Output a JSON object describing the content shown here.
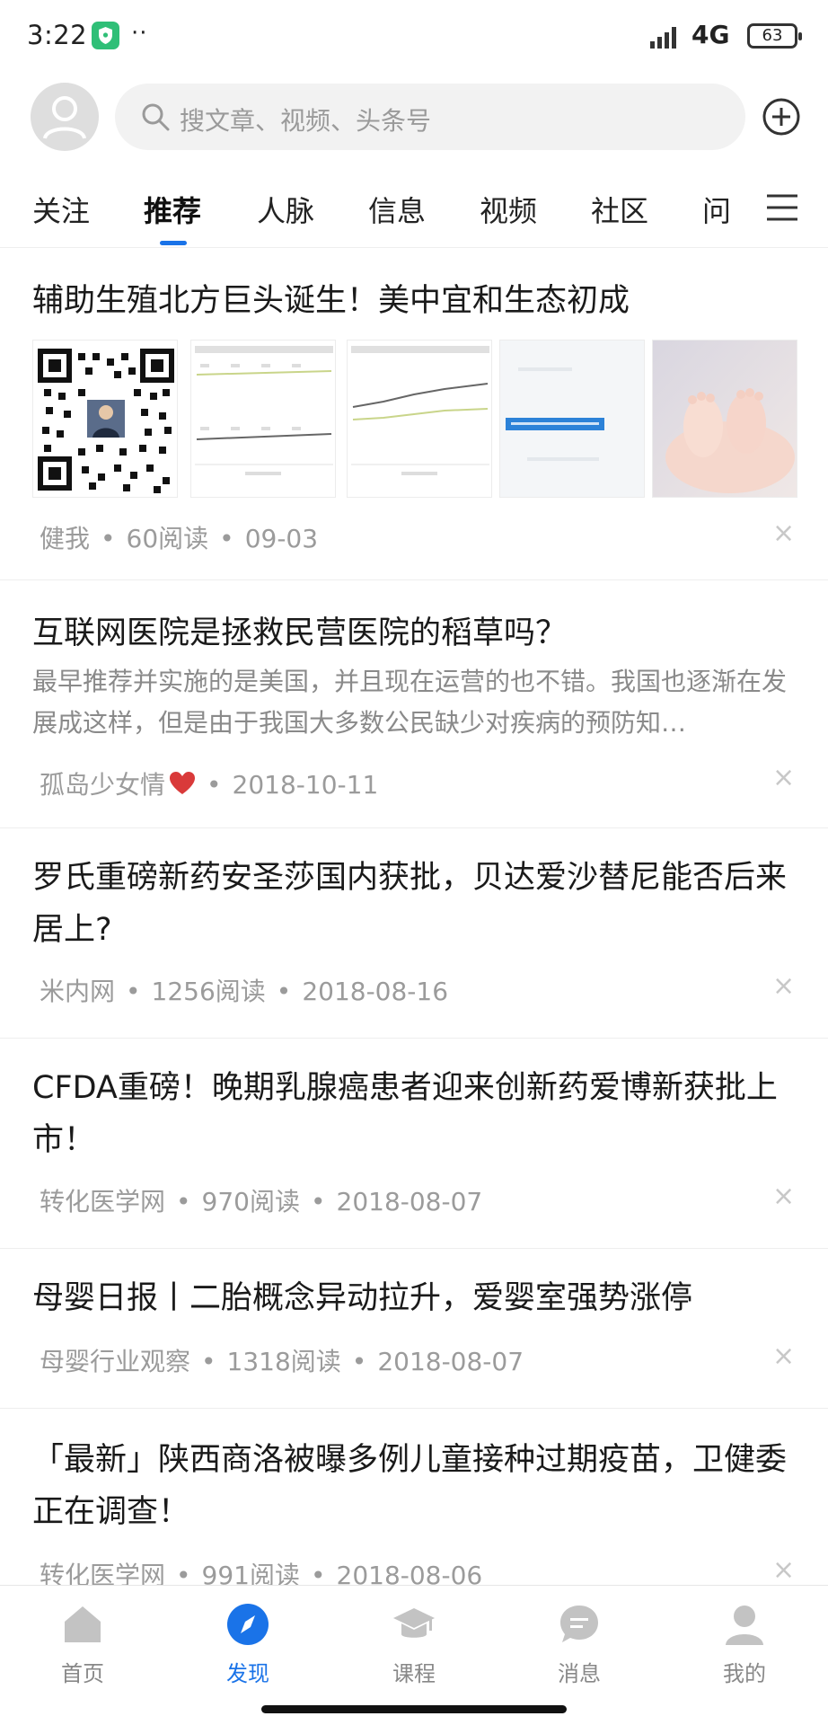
{
  "status_bar": {
    "time": "3:22",
    "dots": "··",
    "network": "4G",
    "battery": "63"
  },
  "header": {
    "search_placeholder": "搜文章、视频、头条号"
  },
  "tabs": [
    {
      "label": "关注"
    },
    {
      "label": "推荐"
    },
    {
      "label": "人脉"
    },
    {
      "label": "信息"
    },
    {
      "label": "视频"
    },
    {
      "label": "社区"
    },
    {
      "label": "问"
    }
  ],
  "active_tab": "推荐",
  "articles": [
    {
      "title": "辅助生殖北方巨头诞生！美中宜和生态初成",
      "source": "健我",
      "reads": "60阅读",
      "date": "09-03",
      "thumbnails": [
        "qr-code",
        "line-chart",
        "line-chart",
        "banner",
        "baby-feet-photo"
      ]
    },
    {
      "title": "互联网医院是拯救民营医院的稻草吗？",
      "desc": "最早推荐并实施的是美国，并且现在运营的也不错。我国也逐渐在发展成这样，但是由于我国大多数公民缺少对疾病的预防知…",
      "source": "孤岛少女情",
      "date": "2018-10-11"
    },
    {
      "title": "罗氏重磅新药安圣莎国内获批，贝达爱沙替尼能否后来居上?",
      "source": "米内网",
      "reads": "1256阅读",
      "date": "2018-08-16"
    },
    {
      "title": "CFDA重磅！晚期乳腺癌患者迎来创新药爱博新获批上市！",
      "source": "转化医学网",
      "reads": "970阅读",
      "date": "2018-08-07"
    },
    {
      "title": "母婴日报丨二胎概念异动拉升，爱婴室强势涨停",
      "source": "母婴行业观察",
      "reads": "1318阅读",
      "date": "2018-08-07"
    },
    {
      "title": "「最新」陕西商洛被曝多例儿童接种过期疫苗，卫健委正在调查！",
      "source": "转化医学网",
      "reads": "991阅读",
      "date": "2018-08-06"
    }
  ],
  "close_glyph": "×",
  "separator": "•",
  "bottom_nav": [
    {
      "label": "首页",
      "icon": "home-icon"
    },
    {
      "label": "发现",
      "icon": "compass-icon"
    },
    {
      "label": "课程",
      "icon": "graduation-cap-icon"
    },
    {
      "label": "消息",
      "icon": "chat-icon"
    },
    {
      "label": "我的",
      "icon": "user-icon"
    }
  ],
  "colors": {
    "accent": "#1a73e8",
    "heart": "#d93a3a",
    "shield": "#2fbf77"
  }
}
